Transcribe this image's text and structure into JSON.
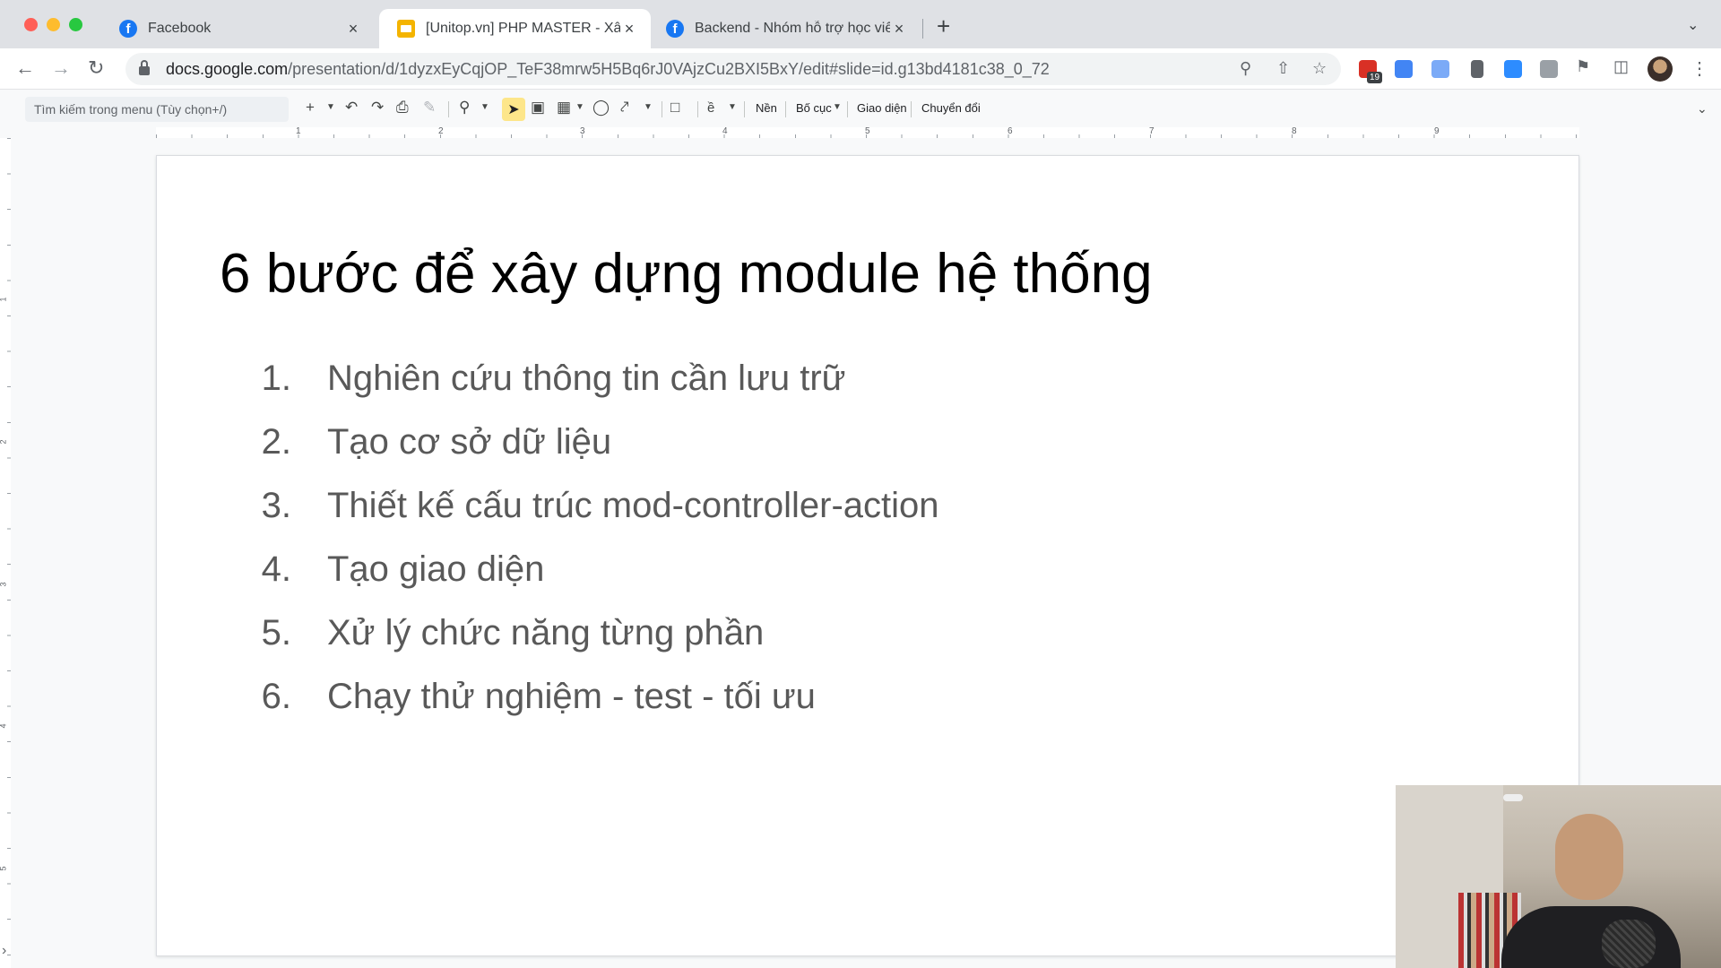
{
  "browser": {
    "tabs": [
      {
        "title": "Facebook",
        "icon": "facebook-icon",
        "close": "×"
      },
      {
        "title": "[Unitop.vn] PHP MASTER - Xây",
        "icon": "google-slides-icon",
        "close": "×",
        "active": true
      },
      {
        "title": "Backend - Nhóm hỗ trợ học viên",
        "icon": "facebook-icon",
        "close": "×"
      }
    ],
    "new_tab": "+",
    "address": {
      "host": "docs.google.com",
      "path": "/presentation/d/1dyzxEyCqjOP_TeF38mrw5H5Bq6rJ0VAjzCu2BXI5BxY/edit#slide=id.g13bd4181c38_0_72"
    },
    "extension_badge": "19"
  },
  "toolbar": {
    "menu_search_placeholder": "Tìm kiếm trong menu (Tùy chọn+/)",
    "background_label": "Nền",
    "layout_label": "Bố cục",
    "theme_label": "Giao diện",
    "transition_label": "Chuyển đổi"
  },
  "ruler": {
    "horizontal": [
      "1",
      "2",
      "3",
      "4",
      "5",
      "6",
      "7",
      "8",
      "9"
    ],
    "vertical": [
      "1",
      "2",
      "3",
      "4",
      "5"
    ]
  },
  "slide": {
    "title": "6 bước để xây dựng module hệ thống",
    "items": [
      {
        "num": "1.",
        "text": "Nghiên cứu thông tin cần lưu trữ"
      },
      {
        "num": "2.",
        "text": "Tạo cơ sở dữ liệu"
      },
      {
        "num": "3.",
        "text": "Thiết kế cấu trúc mod-controller-action"
      },
      {
        "num": "4.",
        "text": "Tạo giao diện"
      },
      {
        "num": "5.",
        "text": "Xử lý chức năng từng phần"
      },
      {
        "num": "6.",
        "text": "Chạy thử nghiệm - test - tối ưu"
      }
    ]
  },
  "colors": {
    "tab_strip": "#dfe1e5",
    "slide_title": "#000000",
    "slide_body": "#595959",
    "selected_tool": "#fde68a"
  }
}
